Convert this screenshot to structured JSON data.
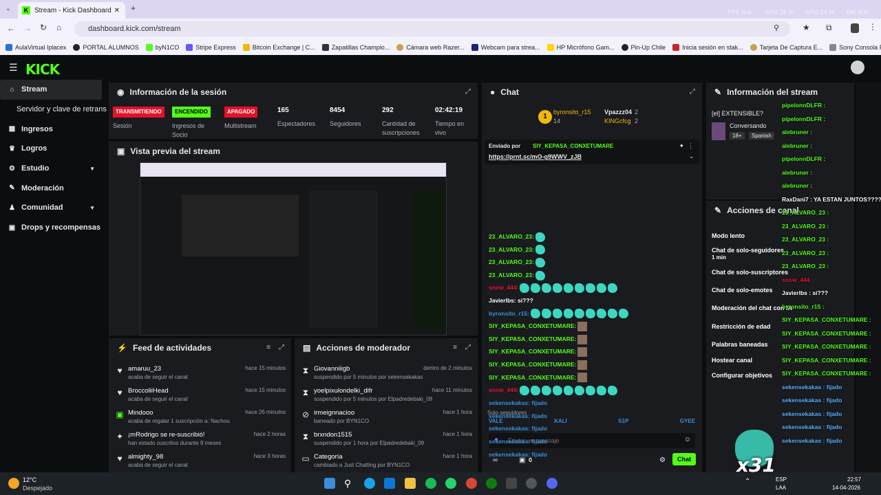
{
  "browser": {
    "tab_title": "Stream - Kick Dashboard",
    "url": "dashboard.kick.com/stream",
    "perf": [
      "FPS N/A",
      "GPU 25 %",
      "CPU 14 %",
      "FM N/A"
    ],
    "bookmarks": [
      "AulaVirtual Iplacex",
      "PORTAL ALUMNOS",
      "byN1CO",
      "Stripe Express",
      "Bitcoin Exchange | C...",
      "Zapatillas Champio...",
      "Cámara web Razer...",
      "Webcam para strea...",
      "HP Micrófono Gam...",
      "Pin-Up Chile",
      "Inicia sesión en stak...",
      "Tarjeta De Captura E...",
      "Sony Consola PlaySt..."
    ]
  },
  "logo": "KICK",
  "sidebar": {
    "items": [
      {
        "label": "Stream",
        "icon": "home-icon"
      },
      {
        "label": "Servidor y clave de retransmisión",
        "icon": ""
      },
      {
        "label": "Ingresos",
        "icon": "revenue-icon"
      },
      {
        "label": "Logros",
        "icon": "trophy-icon"
      },
      {
        "label": "Estudio",
        "icon": "studio-icon"
      },
      {
        "label": "Moderación",
        "icon": "wrench-icon"
      },
      {
        "label": "Comunidad",
        "icon": "community-icon"
      },
      {
        "label": "Drops y recompensas",
        "icon": "gift-icon"
      }
    ]
  },
  "session": {
    "title": "Información de la sesión",
    "stats": [
      {
        "badge": "TRANSMITIENDO",
        "label": "Sesión"
      },
      {
        "badge": "ENCENDIDO",
        "label": "Ingresos de Socio"
      },
      {
        "badge": "APAGADO",
        "label": "Multistream"
      },
      {
        "value": "165",
        "label": "Espectadores"
      },
      {
        "value": "8454",
        "label": "Seguidores"
      },
      {
        "value": "292",
        "label": "Cantidad de suscripciones"
      },
      {
        "value": "02:42:19",
        "label": "Tiempo en vivo"
      }
    ]
  },
  "preview": {
    "title": "Vista previa del stream"
  },
  "feed": {
    "title": "Feed de actividades",
    "items": [
      {
        "name": "amaruu_23",
        "desc": "acaba de seguir el canal",
        "time": "hace 15 minutos"
      },
      {
        "name": "BroccoliiHead",
        "desc": "acaba de seguir el canal",
        "time": "hace 15 minutos"
      },
      {
        "name": "Mindooo",
        "desc": "acaba de regalar 1 suscripción a: Nachou",
        "time": "hace 26 minutos"
      },
      {
        "name": "¡mRodrigo se re-suscribió!",
        "desc": "han estado suscritos durante 9 meses",
        "time": "hace 2 horas"
      },
      {
        "name": "almighty_98",
        "desc": "acaba de seguir el canal",
        "time": "hace 3 horas"
      }
    ]
  },
  "mod": {
    "title": "Acciones de moderador",
    "items": [
      {
        "name": "Giovanniiigb",
        "desc": "suspendido por 5 minutos por sekensekakas",
        "time": "dentro de 2 minutos"
      },
      {
        "name": "yoelpixulondelki_difr",
        "desc": "suspendido por 5 minutos por Elpadredebaki_09",
        "time": "hace 11 minutos"
      },
      {
        "name": "irmeignnacioo",
        "desc": "baneado por BYN1CO",
        "time": "hace 1 hora"
      },
      {
        "name": "brxndon1515",
        "desc": "suspendido por 1 hora por Elpadredebaki_09",
        "time": "hace 1 hora"
      },
      {
        "name": "Categoría",
        "desc": "cambiado a Just Chatting por BYN1CO",
        "time": "hace 1 hora"
      }
    ]
  },
  "chat": {
    "title": "Chat",
    "top_gifters": [
      {
        "rank": "1",
        "name": "byronsito_r15",
        "count": "14"
      },
      {
        "name": "Vpazzz04",
        "count": "2"
      },
      {
        "name": "KINGcfcg",
        "count": "2"
      }
    ],
    "pinned_label": "Enviado por",
    "pinned_by": "SIY_KEPASA_CONXETUMARE",
    "pinned_link": "https://prnt.sc/mO-g9WWV_zJB",
    "messages": [
      {
        "user": "23_ALVARO_23:",
        "color": "#53fc18",
        "emotes": 1,
        "kind": "emo"
      },
      {
        "user": "23_ALVARO_23:",
        "color": "#53fc18",
        "emotes": 1,
        "kind": "emo"
      },
      {
        "user": "23_ALVARO_23:",
        "color": "#53fc18",
        "emotes": 1,
        "kind": "emo"
      },
      {
        "user": "23_ALVARO_23:",
        "color": "#53fc18",
        "emotes": 1,
        "kind": "emo"
      },
      {
        "user": "snow_444:",
        "color": "#e5102a",
        "emotes": 9,
        "kind": "emo"
      },
      {
        "user": "Javierlbs: si???",
        "color": "#ffffff",
        "emotes": 0,
        "kind": "emo"
      },
      {
        "user": "byronsito_r15:",
        "color": "#3b8ed8",
        "emotes": 9,
        "kind": "emo"
      },
      {
        "user": "SIY_KEPASA_CONXETUMARE:",
        "color": "#53fc18",
        "emotes": 1,
        "kind": "pix"
      },
      {
        "user": "SIY_KEPASA_CONXETUMARE:",
        "color": "#53fc18",
        "emotes": 1,
        "kind": "pix"
      },
      {
        "user": "SIY_KEPASA_CONXETUMARE:",
        "color": "#53fc18",
        "emotes": 1,
        "kind": "pix"
      },
      {
        "user": "SIY_KEPASA_CONXETUMARE:",
        "color": "#53fc18",
        "emotes": 1,
        "kind": "pix"
      },
      {
        "user": "SIY_KEPASA_CONXETUMARE:",
        "color": "#53fc18",
        "emotes": 1,
        "kind": "pix"
      },
      {
        "user": "snow_444:",
        "color": "#e5102a",
        "emotes": 9,
        "kind": "emo"
      },
      {
        "user": "sekensekakas: fijado",
        "color": "#3b8ed8",
        "emotes": 0,
        "kind": "emo"
      },
      {
        "user": "sekensekakas: fijado",
        "color": "#3b8ed8",
        "emotes": 0,
        "kind": "emo"
      },
      {
        "user": "sekensekakas: fijado",
        "color": "#3b8ed8",
        "emotes": 0,
        "kind": "emo"
      },
      {
        "user": "sekensekakas: fijado",
        "color": "#3b8ed8",
        "emotes": 0,
        "kind": "emo"
      },
      {
        "user": "sekensekakas: fijado",
        "color": "#3b8ed8",
        "emotes": 0,
        "kind": "emo"
      }
    ],
    "mode": "Solo seguidores",
    "emote_row": [
      "VALE",
      "KALI",
      "S1P",
      "GYEE"
    ],
    "placeholder": "Enviar un mensaje",
    "count": "0",
    "send": "Chat"
  },
  "stream_info": {
    "title": "Información del stream",
    "stream_title": "[el] EXTENSIBLE?",
    "category": "Conversando",
    "tags": [
      "18+",
      "Spanish"
    ]
  },
  "actions": {
    "title": "Acciones de canal",
    "items": [
      "Modo lento",
      "Chat de solo-seguidores",
      "Chat de solo-suscriptores",
      "Chat de solo-emotes",
      "Moderación del chat con IA",
      "Restricción de edad",
      "Palabras baneadas",
      "Hostear canal",
      "Configurar objetivos"
    ],
    "followers_sub": "1 min"
  },
  "overlay": {
    "lines": [
      "pipelonnDLFR :",
      "pipelonnDLFR :",
      "alebruner :",
      "alebruner :",
      "pipelonnDLFR :",
      "alebruner :",
      "alebruner :",
      "RaxDani7 : YA ESTAN JUNTOS???????",
      "23_ALVARO_23 :",
      "23_ALVARO_23 :",
      "23_ALVARO_23 :",
      "23_ALVARO_23 :",
      "23_ALVARO_23 :",
      "snow_444 :",
      "Javierlbs : si???",
      "byronsito_r15 :",
      "SIY_KEPASA_CONXETUMARE :",
      "SIY_KEPASA_CONXETUMARE :",
      "SIY_KEPASA_CONXETUMARE :",
      "SIY_KEPASA_CONXETUMARE :",
      "SIY_KEPASA_CONXETUMARE :",
      "sekensekakas : fijado",
      "sekensekakas : fijado",
      "sekensekakas : fijado",
      "sekensekakas : fijado",
      "sekensekakas : fijado"
    ],
    "x31": "x31"
  },
  "taskbar": {
    "weather_temp": "12°C",
    "weather_desc": "Despejado",
    "lang1": "ESP",
    "lang2": "LAA",
    "time": "22:57",
    "date": "14-04-2026"
  }
}
